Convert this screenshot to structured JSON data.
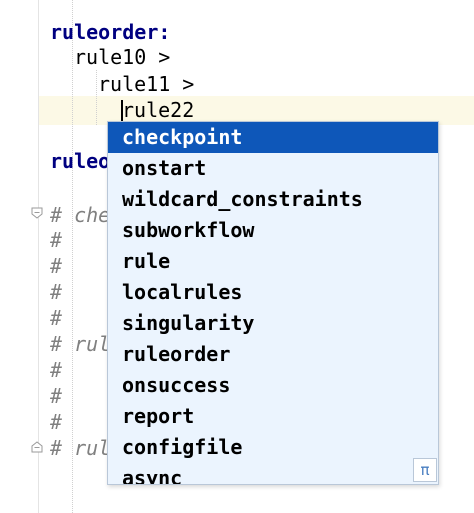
{
  "editor": {
    "lines": [
      {
        "text": "ruleorder:",
        "kind": "kw"
      },
      {
        "text": "rule10 >",
        "kind": "plain"
      },
      {
        "text": "rule11 >",
        "kind": "plain"
      },
      {
        "text": "rule22",
        "kind": "plain"
      },
      {
        "text": "ruleo",
        "kind": "kw"
      },
      {
        "text": "# che",
        "kind": "comment"
      },
      {
        "text": "#",
        "kind": "comment"
      },
      {
        "text": "#",
        "kind": "comment"
      },
      {
        "text": "#",
        "kind": "comment"
      },
      {
        "text": "#",
        "kind": "comment"
      },
      {
        "text": "# rul",
        "kind": "comment"
      },
      {
        "text": "#",
        "kind": "comment"
      },
      {
        "text": "#",
        "kind": "comment"
      },
      {
        "text": "#",
        "kind": "comment"
      },
      {
        "text": "# rul",
        "kind": "comment"
      }
    ]
  },
  "completion": {
    "selected_index": 0,
    "items": [
      "checkpoint",
      "onstart",
      "wildcard_constraints",
      "subworkflow",
      "rule",
      "localrules",
      "singularity",
      "ruleorder",
      "onsuccess",
      "report",
      "configfile",
      "async"
    ],
    "footer_icon": "pi-icon",
    "footer_glyph": "π"
  },
  "colors": {
    "keyword": "#000080",
    "comment": "#808080",
    "selection": "#0e57b9",
    "popup_bg": "#ebf4fe",
    "current_line": "#fcf9e6"
  }
}
